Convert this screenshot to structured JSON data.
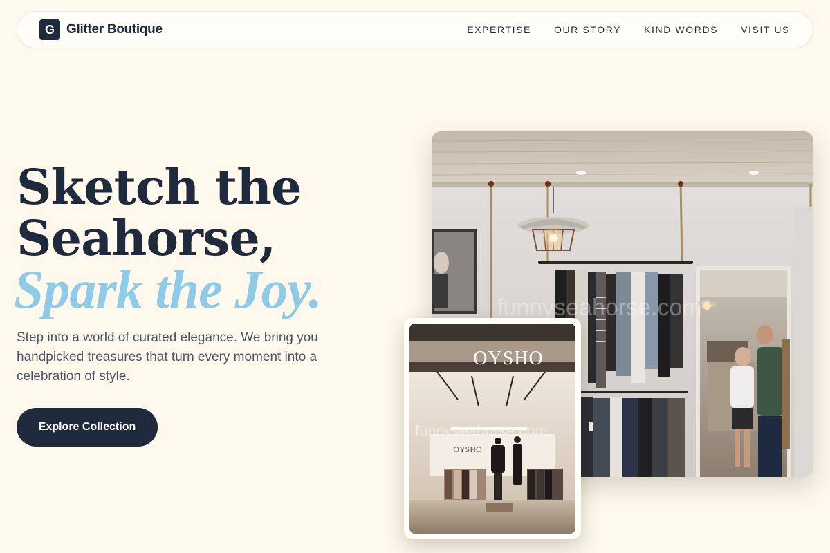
{
  "brand": {
    "logo_letter": "G",
    "name": "Glitter Boutique"
  },
  "nav": {
    "links": [
      "EXPERTISE",
      "OUR STORY",
      "KIND WORDS",
      "VISIT US"
    ]
  },
  "hero": {
    "title_line1": "Sketch the",
    "title_line2": "Seahorse,",
    "title_line3": "Spark the Joy.",
    "description": "Step into a world of curated elegance. We bring you handpicked treasures that turn every moment into a celebration of style.",
    "cta_label": "Explore Collection"
  },
  "images": {
    "main_watermark": "funnyseahorse.com",
    "inset_watermark": "funnyseahorse.com",
    "inset_sign": "OYSHO",
    "inset_small_sign": "OYSHO"
  },
  "colors": {
    "background": "#fef9ec",
    "navy": "#1f2a3d",
    "accent_blue": "#8fcbe6",
    "body_text": "#4a5566"
  }
}
